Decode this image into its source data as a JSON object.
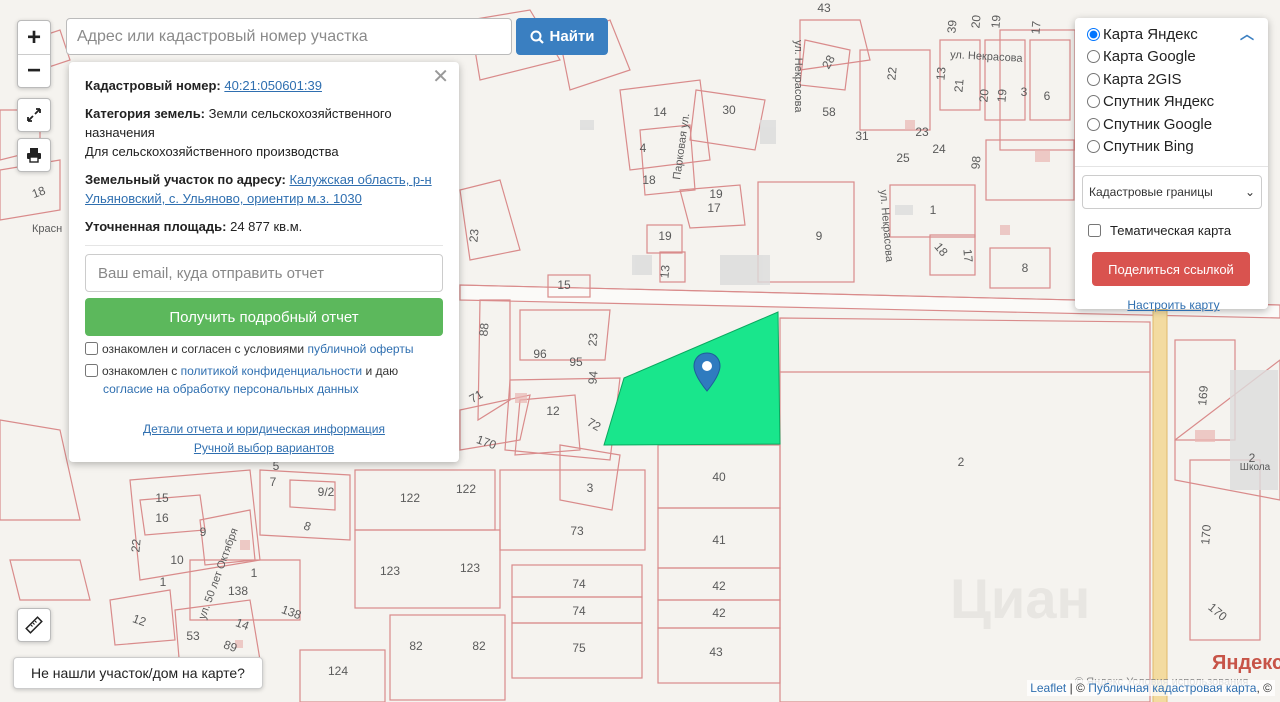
{
  "search": {
    "placeholder": "Адрес или кадастровый номер участка",
    "button_label": "Найти"
  },
  "controls": {
    "zoom_in": "+",
    "zoom_out": "−"
  },
  "info": {
    "cadastral_label": "Кадастровый номер:",
    "cadastral_value": "40:21:050601:39",
    "category_label": "Категория земель:",
    "category_value": "Земли сельскохозяйственного назначения",
    "category_use": "Для сельскохозяйственного производства",
    "address_label": "Земельный участок по адресу:",
    "address_value": "Калужская область, р-н Ульяновский, с. Ульяново, ориентир м.з. 1030",
    "area_label": "Уточненная площадь:",
    "area_value": "24 877 кв.м.",
    "email_placeholder": "Ваш email, куда отправить отчет",
    "report_button": "Получить подробный отчет",
    "consent1_text": "ознакомлен и согласен с условиями",
    "consent1_link": "публичной оферты",
    "consent2_text_a": "ознакомлен с",
    "consent2_link_a": "политикой конфиденциальности",
    "consent2_text_b": "и даю",
    "consent2_link_b": "согласие на обработку персональных данных",
    "details_link": "Детали отчета и юридическая информация",
    "manual_link": "Ручной выбор вариантов"
  },
  "layers": {
    "options": [
      {
        "label": "Карта Яндекс",
        "checked": true
      },
      {
        "label": "Карта Google",
        "checked": false
      },
      {
        "label": "Карта 2GIS",
        "checked": false
      },
      {
        "label": "Спутник Яндекс",
        "checked": false
      },
      {
        "label": "Спутник Google",
        "checked": false
      },
      {
        "label": "Спутник Bing",
        "checked": false
      }
    ],
    "select_value": "Кадастровые границы",
    "thematic_label": "Тематическая карта",
    "share_button": "Поделиться ссылкой",
    "setup_link": "Настроить карту"
  },
  "footer": {
    "not_found": "Не нашли участок/дом на карте?",
    "leaflet": "Leaflet",
    "separator": " | © ",
    "pkk": "Публичная кадастровая карта",
    "tail": ", ©",
    "yandex_logo": "Яндекс",
    "terms": "© Яндекс  Условия использования"
  },
  "map": {
    "highlight_color": "#19e68c",
    "parcel_line_color": "#d98b8b",
    "street_labels": [
      "ул. Некрасова",
      "Парковая ул.",
      "ул. Некрасова",
      "ул. 50 лет Октября",
      "Красн"
    ],
    "plot_labels": [
      "43",
      "39",
      "20",
      "19",
      "17",
      "28",
      "22",
      "13",
      "21",
      "20",
      "19",
      "3",
      "6",
      "14",
      "4",
      "30",
      "58",
      "31",
      "25",
      "23",
      "24",
      "98",
      "18",
      "17",
      "19",
      "13",
      "1",
      "9",
      "18",
      "17",
      "8",
      "23",
      "15",
      "88",
      "96",
      "95",
      "23",
      "94",
      "71",
      "12",
      "72",
      "170",
      "3",
      "40",
      "41",
      "42",
      "42",
      "74",
      "74",
      "73",
      "75",
      "43",
      "122",
      "122",
      "123",
      "123",
      "124",
      "82",
      "82",
      "2",
      "169",
      "170",
      "170",
      "2",
      "15",
      "16",
      "9",
      "22",
      "10",
      "138",
      "138",
      "14",
      "12",
      "53",
      "89",
      "7",
      "9/2",
      "8",
      "1",
      "5",
      "18",
      "1",
      "Школа"
    ]
  }
}
